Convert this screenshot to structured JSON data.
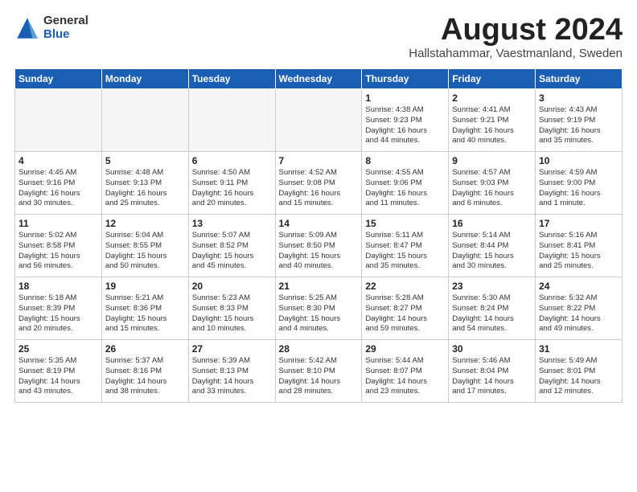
{
  "header": {
    "logo_general": "General",
    "logo_blue": "Blue",
    "month_year": "August 2024",
    "location": "Hallstahammar, Vaestmanland, Sweden"
  },
  "weekdays": [
    "Sunday",
    "Monday",
    "Tuesday",
    "Wednesday",
    "Thursday",
    "Friday",
    "Saturday"
  ],
  "weeks": [
    [
      {
        "day": "",
        "info": ""
      },
      {
        "day": "",
        "info": ""
      },
      {
        "day": "",
        "info": ""
      },
      {
        "day": "",
        "info": ""
      },
      {
        "day": "1",
        "info": "Sunrise: 4:38 AM\nSunset: 9:23 PM\nDaylight: 16 hours\nand 44 minutes."
      },
      {
        "day": "2",
        "info": "Sunrise: 4:41 AM\nSunset: 9:21 PM\nDaylight: 16 hours\nand 40 minutes."
      },
      {
        "day": "3",
        "info": "Sunrise: 4:43 AM\nSunset: 9:19 PM\nDaylight: 16 hours\nand 35 minutes."
      }
    ],
    [
      {
        "day": "4",
        "info": "Sunrise: 4:45 AM\nSunset: 9:16 PM\nDaylight: 16 hours\nand 30 minutes."
      },
      {
        "day": "5",
        "info": "Sunrise: 4:48 AM\nSunset: 9:13 PM\nDaylight: 16 hours\nand 25 minutes."
      },
      {
        "day": "6",
        "info": "Sunrise: 4:50 AM\nSunset: 9:11 PM\nDaylight: 16 hours\nand 20 minutes."
      },
      {
        "day": "7",
        "info": "Sunrise: 4:52 AM\nSunset: 9:08 PM\nDaylight: 16 hours\nand 15 minutes."
      },
      {
        "day": "8",
        "info": "Sunrise: 4:55 AM\nSunset: 9:06 PM\nDaylight: 16 hours\nand 11 minutes."
      },
      {
        "day": "9",
        "info": "Sunrise: 4:57 AM\nSunset: 9:03 PM\nDaylight: 16 hours\nand 6 minutes."
      },
      {
        "day": "10",
        "info": "Sunrise: 4:59 AM\nSunset: 9:00 PM\nDaylight: 16 hours\nand 1 minute."
      }
    ],
    [
      {
        "day": "11",
        "info": "Sunrise: 5:02 AM\nSunset: 8:58 PM\nDaylight: 15 hours\nand 56 minutes."
      },
      {
        "day": "12",
        "info": "Sunrise: 5:04 AM\nSunset: 8:55 PM\nDaylight: 15 hours\nand 50 minutes."
      },
      {
        "day": "13",
        "info": "Sunrise: 5:07 AM\nSunset: 8:52 PM\nDaylight: 15 hours\nand 45 minutes."
      },
      {
        "day": "14",
        "info": "Sunrise: 5:09 AM\nSunset: 8:50 PM\nDaylight: 15 hours\nand 40 minutes."
      },
      {
        "day": "15",
        "info": "Sunrise: 5:11 AM\nSunset: 8:47 PM\nDaylight: 15 hours\nand 35 minutes."
      },
      {
        "day": "16",
        "info": "Sunrise: 5:14 AM\nSunset: 8:44 PM\nDaylight: 15 hours\nand 30 minutes."
      },
      {
        "day": "17",
        "info": "Sunrise: 5:16 AM\nSunset: 8:41 PM\nDaylight: 15 hours\nand 25 minutes."
      }
    ],
    [
      {
        "day": "18",
        "info": "Sunrise: 5:18 AM\nSunset: 8:39 PM\nDaylight: 15 hours\nand 20 minutes."
      },
      {
        "day": "19",
        "info": "Sunrise: 5:21 AM\nSunset: 8:36 PM\nDaylight: 15 hours\nand 15 minutes."
      },
      {
        "day": "20",
        "info": "Sunrise: 5:23 AM\nSunset: 8:33 PM\nDaylight: 15 hours\nand 10 minutes."
      },
      {
        "day": "21",
        "info": "Sunrise: 5:25 AM\nSunset: 8:30 PM\nDaylight: 15 hours\nand 4 minutes."
      },
      {
        "day": "22",
        "info": "Sunrise: 5:28 AM\nSunset: 8:27 PM\nDaylight: 14 hours\nand 59 minutes."
      },
      {
        "day": "23",
        "info": "Sunrise: 5:30 AM\nSunset: 8:24 PM\nDaylight: 14 hours\nand 54 minutes."
      },
      {
        "day": "24",
        "info": "Sunrise: 5:32 AM\nSunset: 8:22 PM\nDaylight: 14 hours\nand 49 minutes."
      }
    ],
    [
      {
        "day": "25",
        "info": "Sunrise: 5:35 AM\nSunset: 8:19 PM\nDaylight: 14 hours\nand 43 minutes."
      },
      {
        "day": "26",
        "info": "Sunrise: 5:37 AM\nSunset: 8:16 PM\nDaylight: 14 hours\nand 38 minutes."
      },
      {
        "day": "27",
        "info": "Sunrise: 5:39 AM\nSunset: 8:13 PM\nDaylight: 14 hours\nand 33 minutes."
      },
      {
        "day": "28",
        "info": "Sunrise: 5:42 AM\nSunset: 8:10 PM\nDaylight: 14 hours\nand 28 minutes."
      },
      {
        "day": "29",
        "info": "Sunrise: 5:44 AM\nSunset: 8:07 PM\nDaylight: 14 hours\nand 23 minutes."
      },
      {
        "day": "30",
        "info": "Sunrise: 5:46 AM\nSunset: 8:04 PM\nDaylight: 14 hours\nand 17 minutes."
      },
      {
        "day": "31",
        "info": "Sunrise: 5:49 AM\nSunset: 8:01 PM\nDaylight: 14 hours\nand 12 minutes."
      }
    ]
  ]
}
